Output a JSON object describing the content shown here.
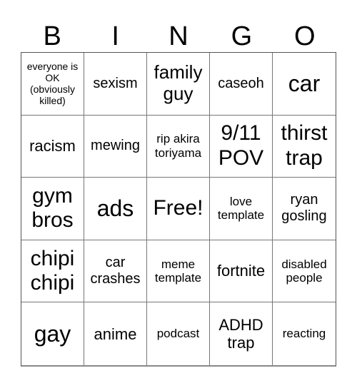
{
  "header": {
    "letters": [
      "B",
      "I",
      "N",
      "G",
      "O"
    ]
  },
  "cells": [
    "everyone is OK (obviously killed)",
    "sexism",
    "family guy",
    "caseoh",
    "car",
    "racism",
    "mewing",
    "rip akira toriyama",
    "9/11 POV",
    "thirst trap",
    "gym bros",
    "ads",
    "Free!",
    "love template",
    "ryan gosling",
    "chipi chipi",
    "car crashes",
    "meme template",
    "fortnite",
    "disabled people",
    "gay",
    "anime",
    "podcast",
    "ADHD trap",
    "reacting"
  ]
}
